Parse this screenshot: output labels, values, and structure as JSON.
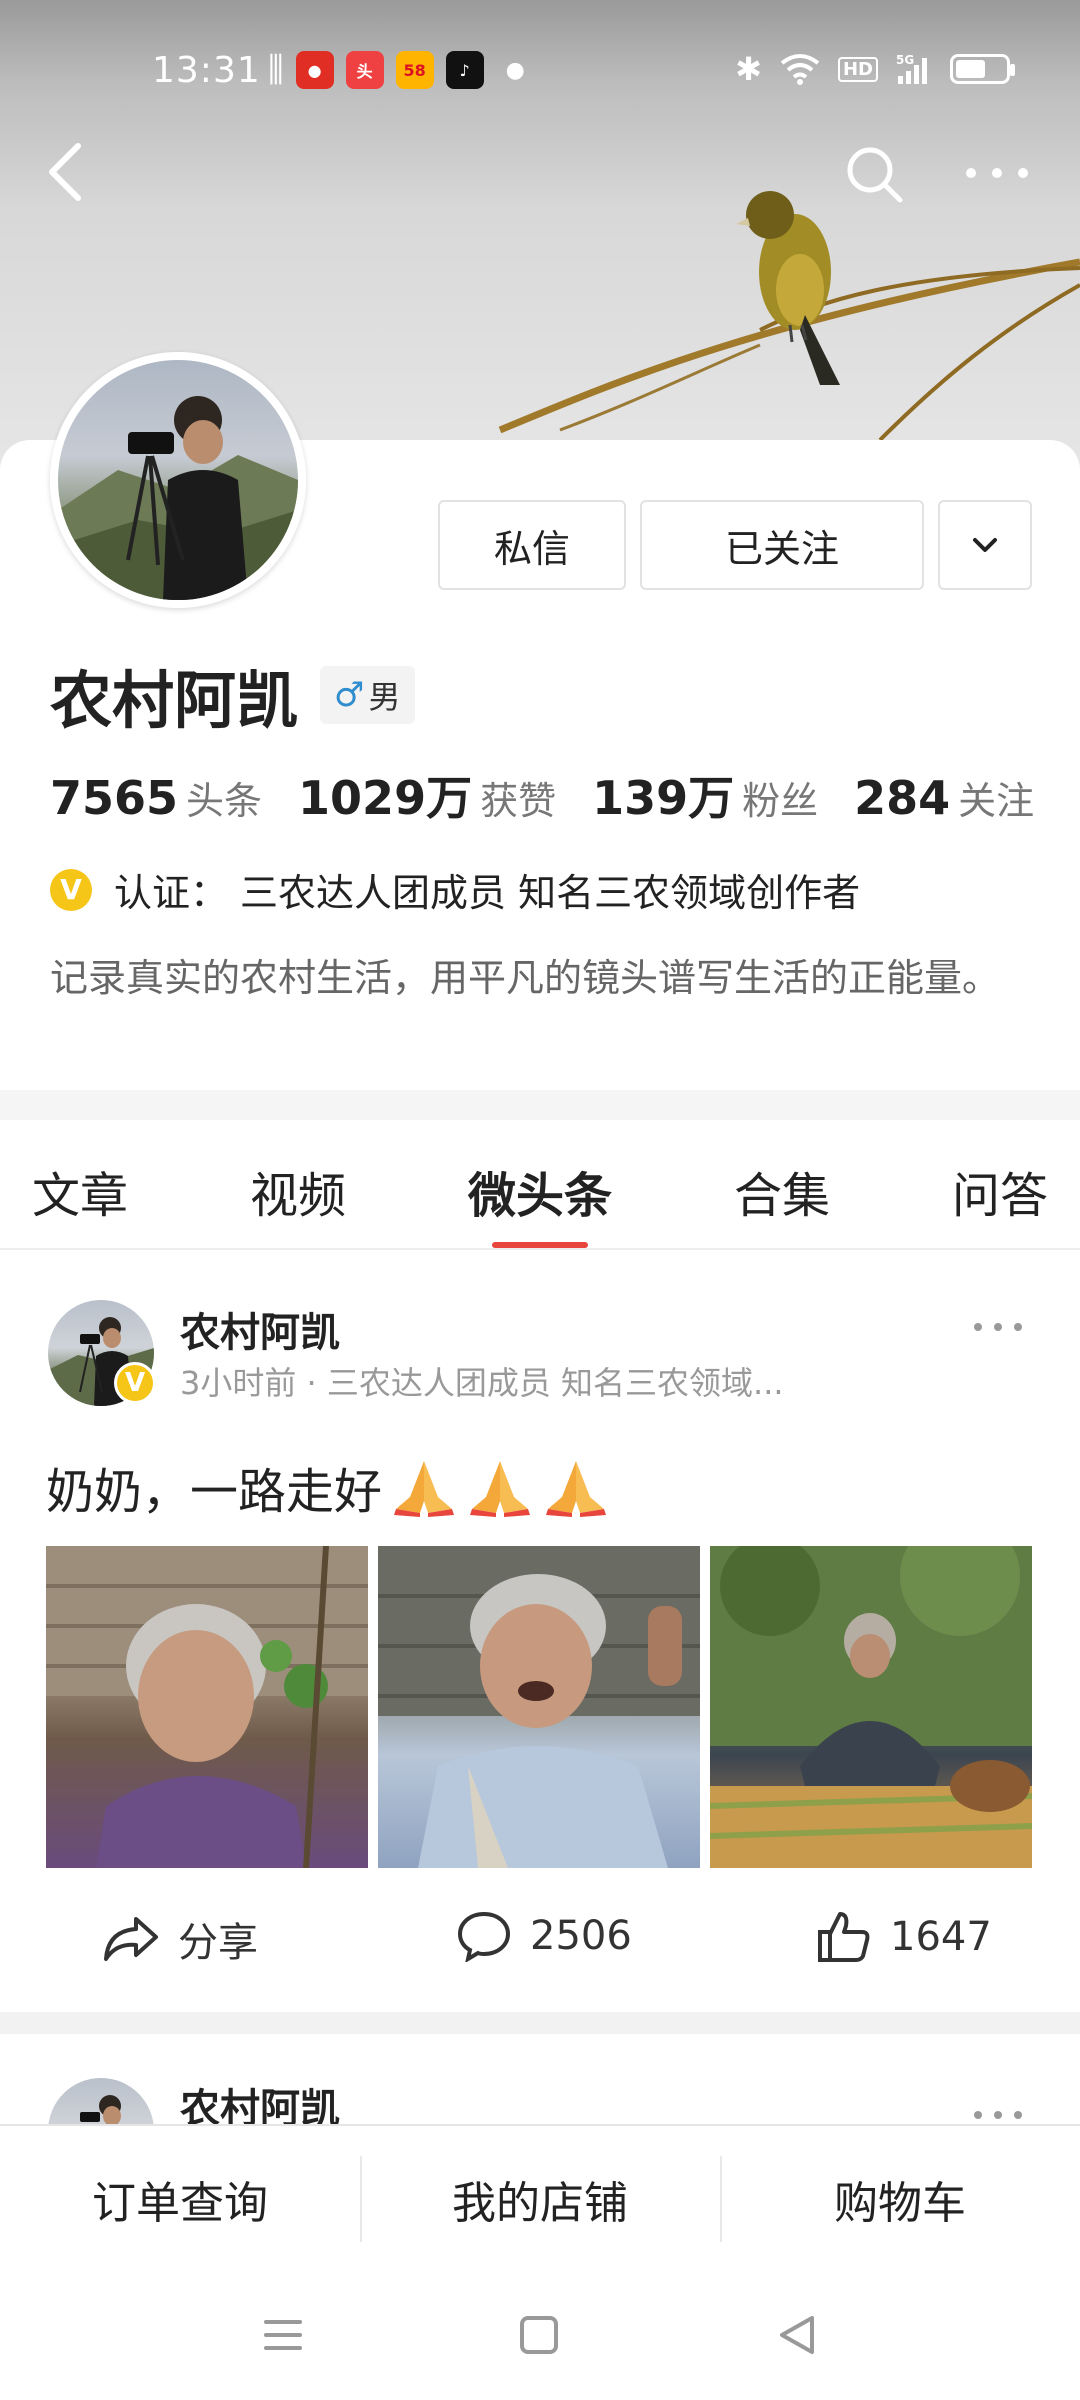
{
  "status_bar": {
    "time": "13:31",
    "left_icons": [
      "listen-icon",
      "app-pinduoduo-icon",
      "app-toutiao-icon",
      "app-58-icon",
      "app-tiktok-icon",
      "dot-icon"
    ],
    "right_icons": [
      "bluetooth-icon",
      "wifi-icon",
      "hd-icon",
      "signal-5g-icon",
      "battery-icon"
    ],
    "hd_label": "HD",
    "battery_level": 0.6
  },
  "header": {
    "back_icon": "chevron-left-icon",
    "search_icon": "search-icon",
    "more_icon": "more-dots-icon"
  },
  "profile": {
    "name": "农村阿凯",
    "gender_symbol": "♂",
    "gender_label": "男",
    "buttons": {
      "message": "私信",
      "follow": "已关注",
      "dropdown_icon": "chevron-down-icon"
    },
    "stats": [
      {
        "value": "7565",
        "label": "头条"
      },
      {
        "value": "1029万",
        "label": "获赞"
      },
      {
        "value": "139万",
        "label": "粉丝"
      },
      {
        "value": "284",
        "label": "关注"
      }
    ],
    "verification": {
      "icon_text": "V",
      "label": "认证：",
      "text": "三农达人团成员 知名三农领域创作者"
    },
    "bio": "记录真实的农村生活，用平凡的镜头谱写生活的正能量。"
  },
  "tabs": {
    "items": [
      "文章",
      "视频",
      "微头条",
      "合集",
      "问答"
    ],
    "active_index": 2
  },
  "posts": [
    {
      "author": "农村阿凯",
      "meta": "3小时前 · 三农达人团成员 知名三农领域...",
      "text": "奶奶，一路走好",
      "emojis": [
        "folded-hands-icon",
        "folded-hands-icon",
        "folded-hands-icon"
      ],
      "actions": {
        "share_label": "分享",
        "comment_count": "2506",
        "like_count": "1647"
      }
    },
    {
      "author": "农村阿凯"
    }
  ],
  "shop_bar": {
    "items": [
      "订单查询",
      "我的店铺",
      "购物车"
    ]
  },
  "system_nav": {
    "icons": [
      "menu-icon",
      "home-square-icon",
      "back-triangle-icon"
    ]
  },
  "colors": {
    "accent": "#e8453c",
    "verify_badge": "#f5c518",
    "gender_symbol": "#2f8ccd"
  }
}
